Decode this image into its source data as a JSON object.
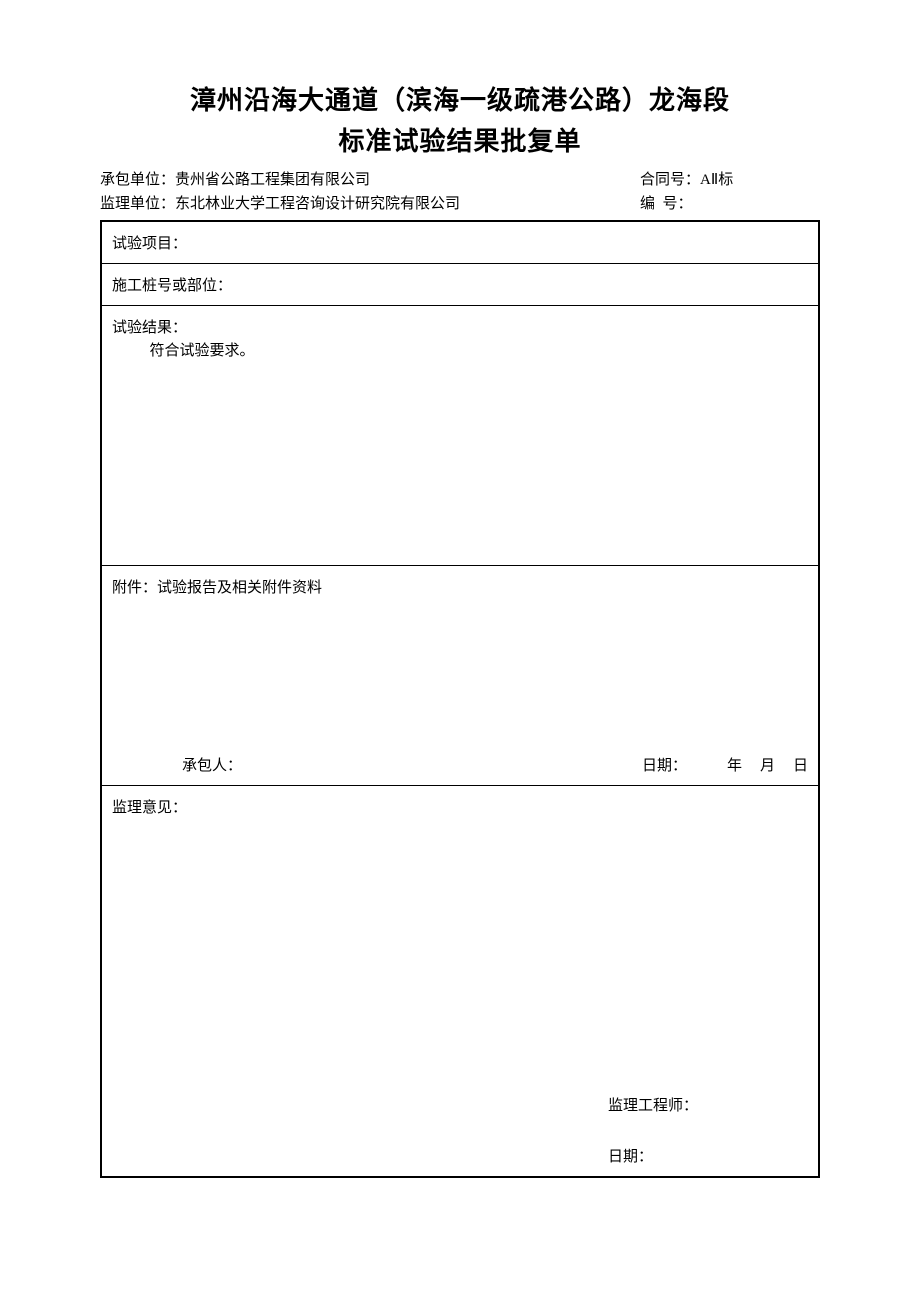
{
  "title_line1": "漳州沿海大通道（滨海一级疏港公路）龙海段",
  "title_line2": "标准试验结果批复单",
  "meta": {
    "contractor_label": "承包单位：",
    "contractor_value": "贵州省公路工程集团有限公司",
    "supervisor_label": "监理单位：",
    "supervisor_value": "东北林业大学工程咨询设计研究院有限公司",
    "contract_no_label": "合同号：",
    "contract_no_value": "AⅡ标",
    "serial_label_a": "编",
    "serial_label_b": "号：",
    "serial_value": ""
  },
  "cells": {
    "test_item_label": "试验项目：",
    "station_label": "施工桩号或部位：",
    "result_label": "试验结果：",
    "result_body": "符合试验要求。",
    "attachment_label": "附件：",
    "attachment_value": "试验报告及相关附件资料",
    "contractor_person_label": "承包人：",
    "date_label": "日期：",
    "year_unit": "年",
    "month_unit": "月",
    "day_unit": "日",
    "opinion_label": "监理意见：",
    "engineer_label": "监理工程师：",
    "opinion_date_label": "日期："
  }
}
